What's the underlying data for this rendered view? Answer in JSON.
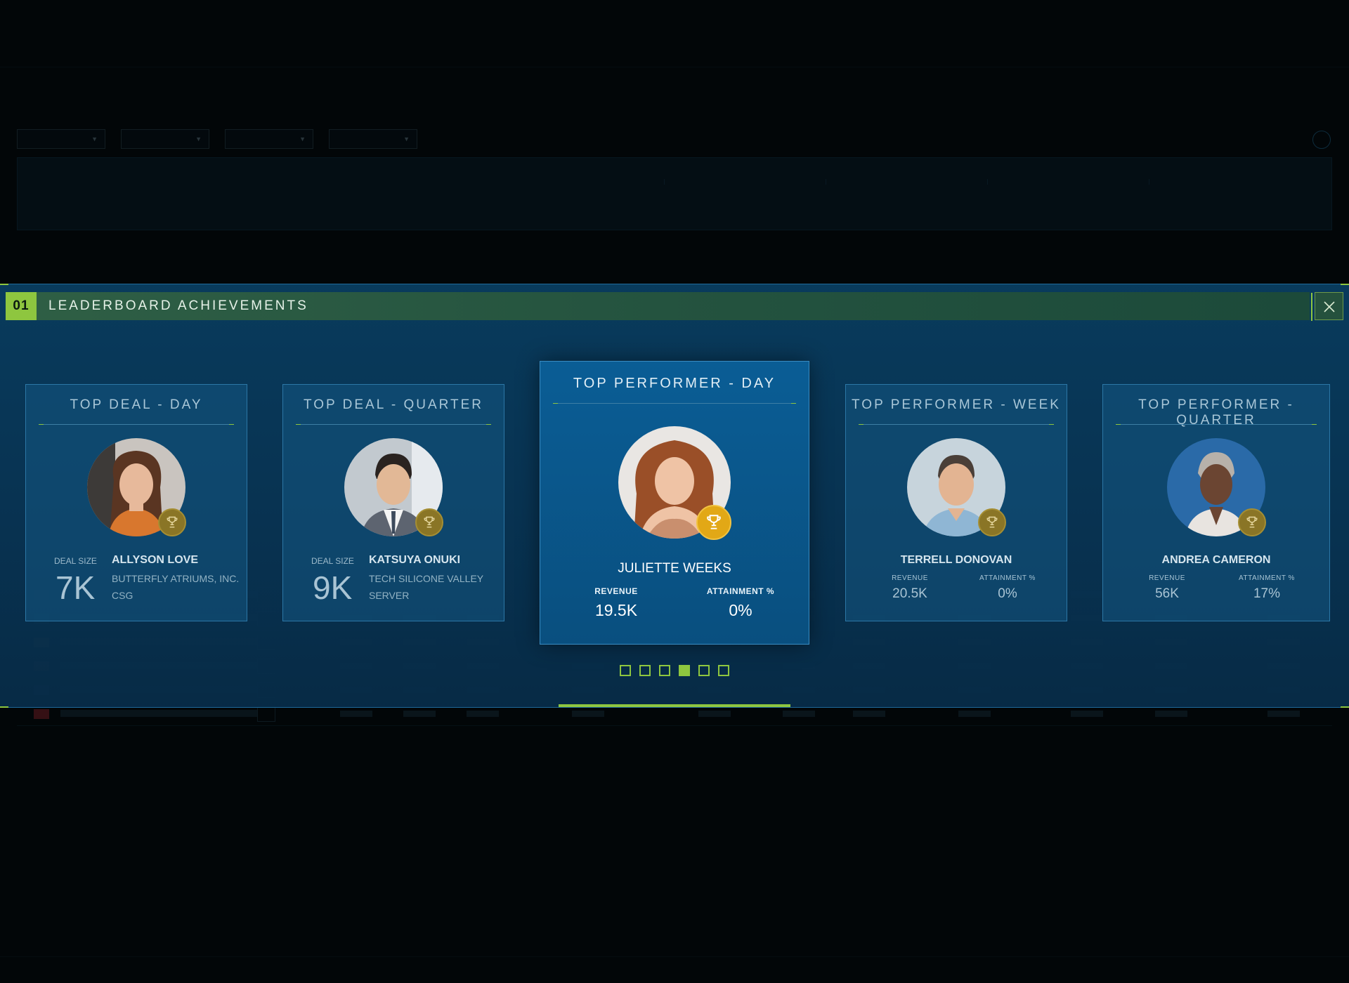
{
  "modal": {
    "number": "01",
    "title": "LEADERBOARD ACHIEVEMENTS",
    "close_icon": "close-icon"
  },
  "cards": [
    {
      "heading": "TOP DEAL - DAY",
      "type": "deal",
      "deal_label": "DEAL SIZE",
      "deal_value": "7K",
      "name": "ALLYSON LOVE",
      "company": "BUTTERFLY ATRIUMS, INC. CSG",
      "icon": "trophy-icon"
    },
    {
      "heading": "TOP DEAL - QUARTER",
      "type": "deal",
      "deal_label": "DEAL SIZE",
      "deal_value": "9K",
      "name": "KATSUYA ONUKI",
      "company": "TECH SILICONE VALLEY SERVER",
      "icon": "trophy-icon"
    },
    {
      "heading": "TOP PERFORMER - DAY",
      "type": "performer",
      "featured": true,
      "name": "JULIETTE WEEKS",
      "stats": [
        {
          "label": "REVENUE",
          "value": "19.5K"
        },
        {
          "label": "ATTAINMENT %",
          "value": "0%"
        }
      ],
      "icon": "trophy-icon"
    },
    {
      "heading": "TOP PERFORMER - WEEK",
      "type": "performer",
      "name": "TERRELL DONOVAN",
      "stats": [
        {
          "label": "REVENUE",
          "value": "20.5K"
        },
        {
          "label": "ATTAINMENT %",
          "value": "0%"
        }
      ],
      "icon": "trophy-icon"
    },
    {
      "heading": "TOP PERFORMER - QUARTER",
      "type": "performer",
      "name": "ANDREA CAMERON",
      "stats": [
        {
          "label": "REVENUE",
          "value": "56K"
        },
        {
          "label": "ATTAINMENT %",
          "value": "17%"
        }
      ],
      "icon": "trophy-icon"
    }
  ],
  "pager": {
    "count": 6,
    "active_index": 3
  },
  "colors": {
    "accent_green": "#8ec63f",
    "band_blue": "#0a3d60",
    "trophy_gold": "#e2a816"
  }
}
